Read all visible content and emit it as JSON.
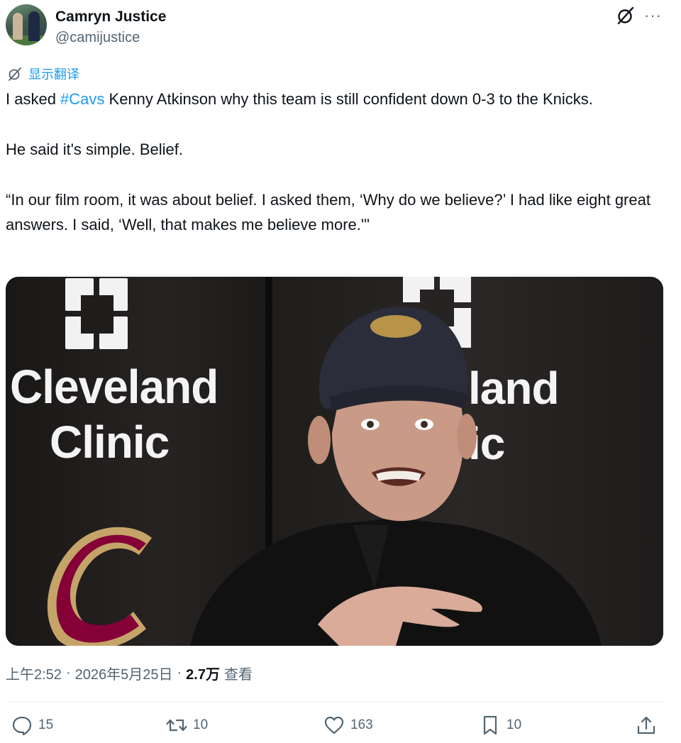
{
  "author": {
    "name": "Camryn Justice",
    "handle": "@camijustice"
  },
  "header_icons": [
    "grok-icon",
    "more-icon"
  ],
  "translate": {
    "icon": "grok-translate-icon",
    "label": "显示翻译"
  },
  "tweet": {
    "line1_prefix": "I asked ",
    "hashtag": "#Cavs",
    "line1_suffix": " Kenny Atkinson why this team is still confident down 0-3 to the Knicks.",
    "para2": "He said it's simple. Belief.",
    "para3": "“In our film room, it was about belief. I asked them, ‘Why do we believe?’ I had like eight great answers. I said, ‘Well, that makes me believe more.'\""
  },
  "media": {
    "wordmark_line1": "Cleveland",
    "wordmark_line2": "Clinic",
    "wordmark_partial_line1": "land",
    "wordmark_partial_line2": "ic",
    "colors": {
      "backdrop": "#1d1b1b",
      "wine": "#860038",
      "gold": "#c4a468"
    }
  },
  "meta": {
    "time": "上午2:52",
    "date": "2026年5月25日",
    "separator": "·",
    "views_count": "2.7万",
    "views_label": "查看"
  },
  "actions": {
    "reply": {
      "icon": "reply-icon",
      "count": "15"
    },
    "repost": {
      "icon": "repost-icon",
      "count": "10"
    },
    "like": {
      "icon": "heart-icon",
      "count": "163"
    },
    "bookmark": {
      "icon": "bookmark-icon",
      "count": "10"
    },
    "share": {
      "icon": "share-icon"
    }
  },
  "colors": {
    "accent": "#1d9bf0",
    "secondary_text": "#536471",
    "text": "#0f1419"
  }
}
